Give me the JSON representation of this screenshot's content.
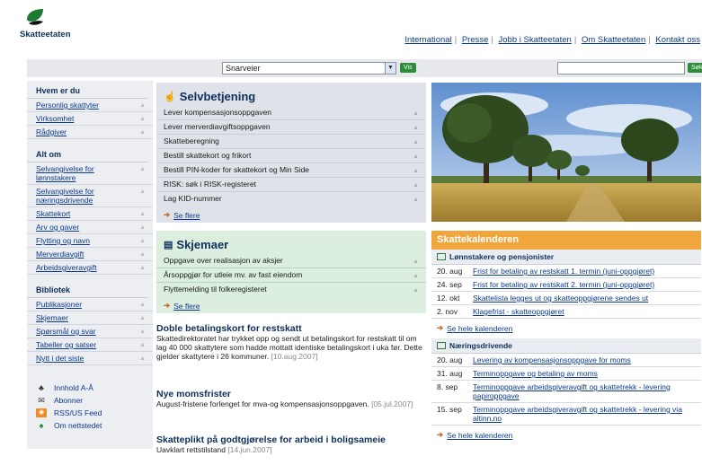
{
  "brand": "Skatteetaten",
  "topnav": [
    "International",
    "Presse",
    "Jobb i Skatteetaten",
    "Om Skatteetaten",
    "Kontakt oss"
  ],
  "search": {
    "shortcut_value": "Snarveier",
    "vis_label": "Vis",
    "sok_label": "Søk"
  },
  "leftnav": {
    "sections": [
      {
        "title": "Hvem er du",
        "items": [
          "Personlig skattyter",
          "Virksomhet",
          "Rådgiver"
        ]
      },
      {
        "title": "Alt om",
        "items": [
          "Selvangivelse for\nlønnstakere",
          "Selvangivelse for\nnæringsdrivende",
          "Skattekort",
          "Arv og gaver",
          "Flytting og navn",
          "Merverdiavgift",
          "Arbeidsgiveravgift"
        ]
      },
      {
        "title": "Bibliotek",
        "items": [
          "Publikasjoner",
          "Skjemaer",
          "Spørsmål og svar",
          "Tabeller og satser",
          "Nytt i det siste"
        ]
      }
    ],
    "extras": [
      {
        "icon": "hierarchy-icon",
        "label": "Innhold A-Å"
      },
      {
        "icon": "envelope-icon",
        "label": "Abonner"
      },
      {
        "icon": "rss-icon",
        "label": "RSS/US Feed"
      },
      {
        "icon": "leaf-logo-icon",
        "label": "Om nettstedet"
      }
    ]
  },
  "selvbetjening": {
    "title": "Selvbetjening",
    "items": [
      "Lever kompensasjonsoppgaven",
      "Lever merverdiavgiftsoppgaven",
      "Skatteberegning",
      "Bestill skattekort og frikort",
      "Bestill PIN-koder for skattekort og Min Side",
      "RISK: søk i RISK-registeret",
      "Lag KID-nummer"
    ],
    "more": "Se flere"
  },
  "skjemaer": {
    "title": "Skjemaer",
    "items": [
      "Oppgave over realisasjon av aksjer",
      "Årsoppgjør for utleie mv. av fast eiendom",
      "Flyttemelding til folkeregisteret"
    ],
    "more": "Se flere"
  },
  "news": [
    {
      "title": "Doble betalingskort for restskatt",
      "text": "Skattedirektoratet har trykket opp og sendt ut betalingskort for restskatt til om lag 40 000 skattytere som hadde mottatt identiske betalingskort i uka før. Dette gjelder skattytere i 26 kommuner.",
      "date": "[10.aug.2007]"
    },
    {
      "title": "Nye momsfrister",
      "text": "August-fristene forlenget for mva-og kompensasjonsoppgaven.",
      "date": "[05.jul.2007]"
    },
    {
      "title": "Skatteplikt på godtgjørelse for arbeid i boligsameie",
      "text": "Uavklart rettstilstand",
      "date": "[14.jun.2007]"
    }
  ],
  "calendar": {
    "title": "Skattekalenderen",
    "groups": [
      {
        "title": "Lønnstakere og pensjonister",
        "rows": [
          {
            "date": "20. aug",
            "text": "Frist for betaling av restskatt 1. termin (juni-oppgjøret)"
          },
          {
            "date": "24. sep",
            "text": "Frist for betaling av restskatt 2. termin (juni-oppgjøret)"
          },
          {
            "date": "12. okt",
            "text": "Skattelista legges ut og skatteoppgjørene sendes ut"
          },
          {
            "date": "2. nov",
            "text": "Klagefrist - skatteoppgjøret"
          }
        ],
        "more": "Se hele kalenderen"
      },
      {
        "title": "Næringsdrivende",
        "rows": [
          {
            "date": "20. aug",
            "text": "Levering av kompensasjonsoppgave for moms"
          },
          {
            "date": "31. aug",
            "text": "Terminoppgave og betaling av moms"
          },
          {
            "date": "8. sep",
            "text": "Terminoppgave arbeidsgiveravgift og skattetrekk - levering papiroppgave"
          },
          {
            "date": "15. sep",
            "text": "Terminoppgave arbeidsgiveravgift og skattetrekk - levering via altinn.no"
          }
        ],
        "more": "Se hele kalenderen"
      }
    ]
  },
  "colors": {
    "brand": "#0d2f5c",
    "accent": "#2e8b3a",
    "calendar": "#f0a63c"
  }
}
